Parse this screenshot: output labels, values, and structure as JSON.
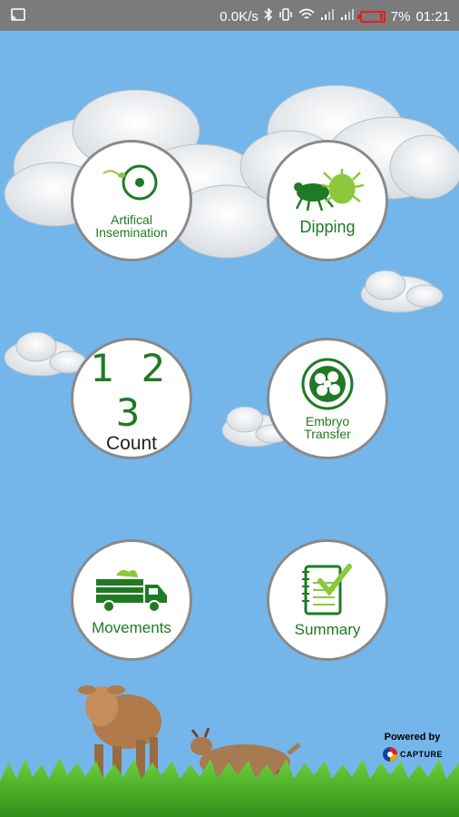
{
  "status_bar": {
    "speed": "0.0K/s",
    "battery_percent": "7%",
    "time": "01:21",
    "icons": [
      "cast-icon",
      "bluetooth-icon",
      "vibrate-icon",
      "wifi-icon",
      "signal-icon",
      "signal-icon",
      "battery-icon"
    ]
  },
  "menu": {
    "ai_label_line1": "Artifical",
    "ai_label_line2": "Insemination",
    "dipping_label": "Dipping",
    "count_digits": "1 2 3",
    "count_label": "Count",
    "embryo_label_line1": "Embryo",
    "embryo_label_line2": "Transfer",
    "movements_label": "Movements",
    "summary_label": "Summary"
  },
  "footer": {
    "powered_by": "Powered by",
    "brand": "CAPTURE"
  },
  "colors": {
    "sky": "#74b6ea",
    "icon_green": "#1f7a23",
    "accent_green": "#8cc83c",
    "battery_red": "#e02020"
  }
}
